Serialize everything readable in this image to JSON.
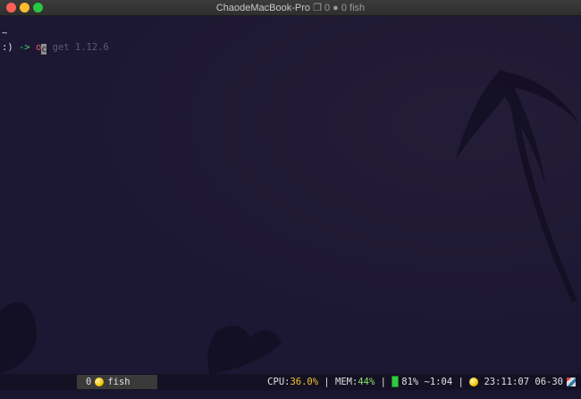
{
  "window": {
    "title": "ChaodeMacBook-Pro",
    "title_suffix": "❒ 0 ● 0 fish"
  },
  "terminal": {
    "line1": "~",
    "prompt_smile": ":)",
    "prompt_arrow": "->",
    "typed": "o",
    "cursor_char": "c",
    "suggestion": " get 1.12.6"
  },
  "statusbar": {
    "tab_index": "0",
    "tab_name": "fish",
    "cpu_label": "CPU:",
    "cpu_value": "36.0%",
    "mem_label": " | MEM:",
    "mem_value": "44%",
    "sep": " | ",
    "battery": "81% ~1:04",
    "sep2": " | ",
    "clock": "23:11:07 06-30"
  },
  "colors": {
    "background": "#1b1630",
    "prompt_arrow": "#3fd46a",
    "typed": "#e2566b",
    "highlight": "#f0c22b"
  }
}
